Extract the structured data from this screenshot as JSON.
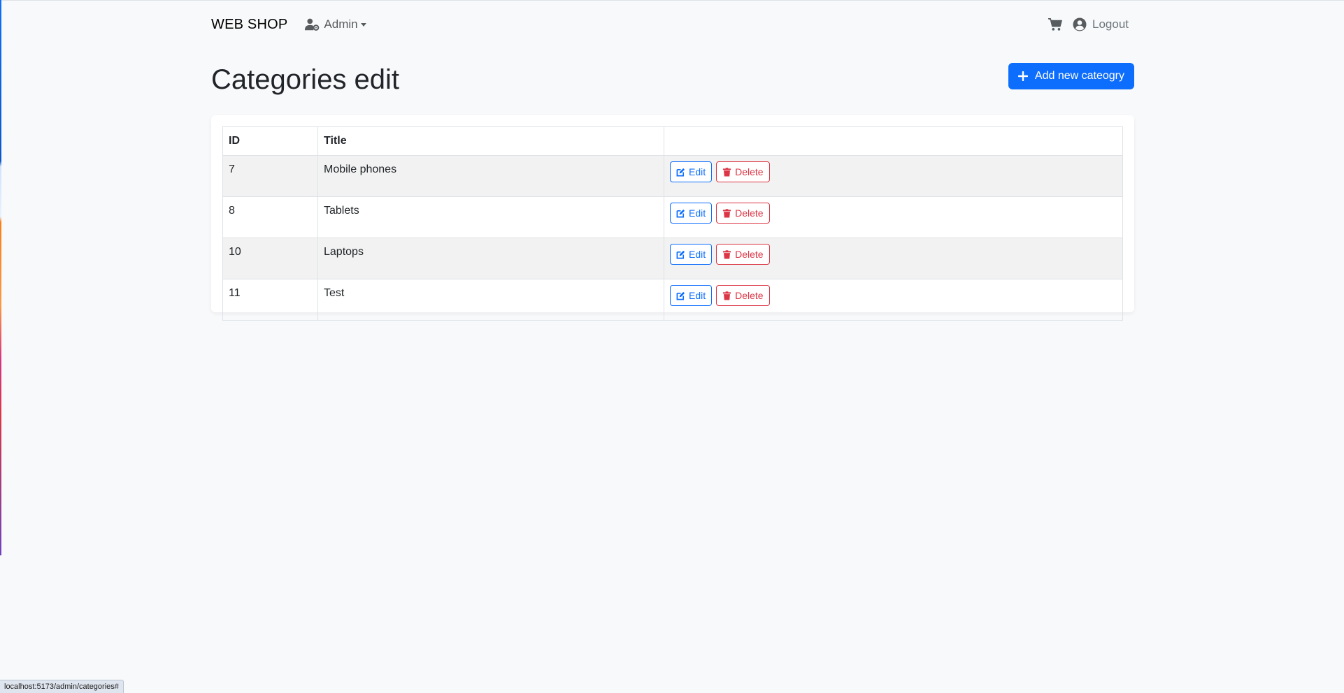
{
  "navbar": {
    "brand": "WEB SHOP",
    "admin_label": "Admin",
    "logout_label": "Logout",
    "icons": {
      "admin": "user-gear-icon",
      "cart": "cart-icon",
      "logout": "user-circle-icon"
    }
  },
  "page": {
    "title": "Categories edit",
    "add_button_label": "Add new cateogry"
  },
  "table": {
    "headers": {
      "id": "ID",
      "title": "Title",
      "actions": ""
    },
    "rows": [
      {
        "id": "7",
        "title": "Mobile phones"
      },
      {
        "id": "8",
        "title": "Tablets"
      },
      {
        "id": "10",
        "title": "Laptops"
      },
      {
        "id": "11",
        "title": "Test"
      }
    ],
    "edit_label": "Edit",
    "delete_label": "Delete"
  },
  "status_bar": {
    "url": "localhost:5173/admin/categories#"
  },
  "colors": {
    "primary": "#0d6efd",
    "danger": "#dc3545",
    "background": "#f8f9fa",
    "stripe": "#f2f2f2"
  }
}
